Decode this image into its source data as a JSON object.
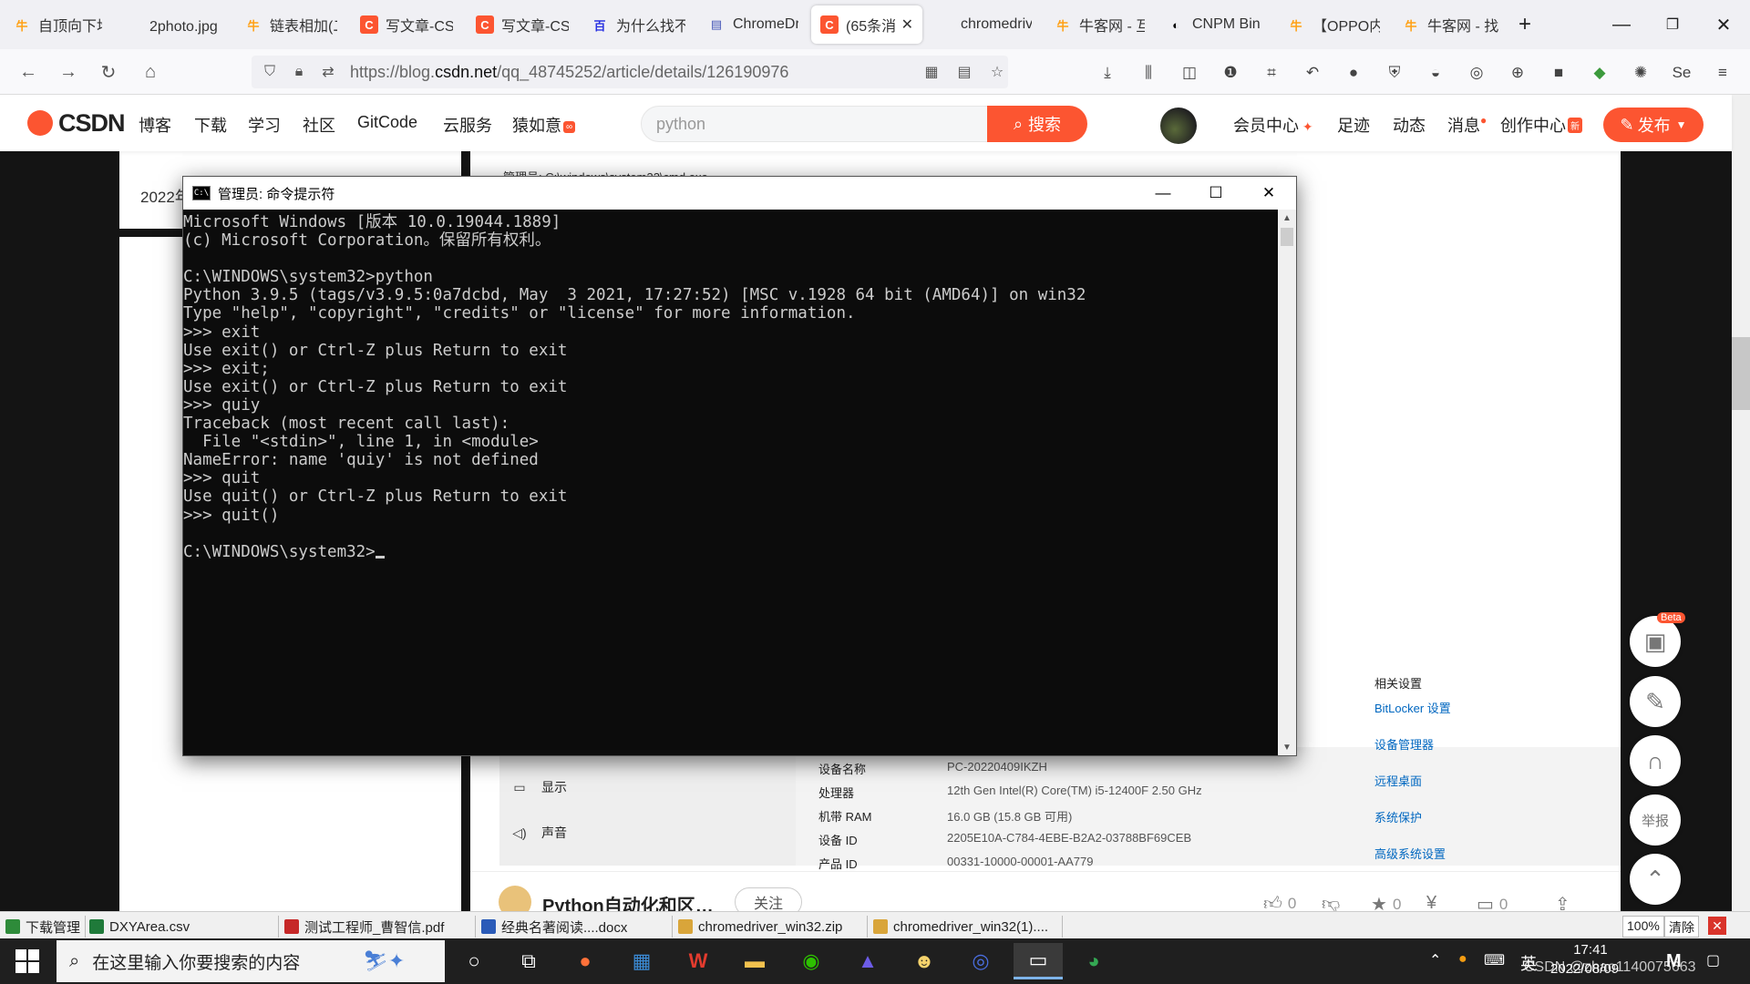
{
  "browser": {
    "tabs": [
      {
        "title": "自顶向下堆",
        "fav": "牛"
      },
      {
        "title": "2photo.jpg（",
        "fav": ""
      },
      {
        "title": "链表相加(二",
        "fav": "牛"
      },
      {
        "title": "写文章-CSI",
        "fav": "C"
      },
      {
        "title": "写文章-CSI",
        "fav": "C"
      },
      {
        "title": "为什么找不",
        "fav": "百"
      },
      {
        "title": "ChromeDr",
        "fav": "▤"
      },
      {
        "title": "(65条消",
        "fav": "C"
      },
      {
        "title": "chromedriver",
        "fav": ""
      },
      {
        "title": "牛客网 - 互",
        "fav": "牛"
      },
      {
        "title": "CNPM Bin",
        "fav": "◐"
      },
      {
        "title": "【OPPO内",
        "fav": "牛"
      },
      {
        "title": "牛客网 - 找",
        "fav": "牛"
      }
    ],
    "new_tab": "+",
    "window_controls": {
      "minimize": "—",
      "restore": "❐",
      "close": "✕"
    },
    "url": {
      "prefix": "https://blog.",
      "domain": "csdn.net",
      "path": "/qq_48745252/article/details/126190976"
    },
    "icons": [
      "back-icon",
      "forward-icon",
      "reload-icon",
      "home-icon",
      "shield-icon",
      "lock-icon",
      "tracking-icon",
      "qr-icon",
      "reader-icon",
      "bookmark-star-icon"
    ]
  },
  "csdn": {
    "logo": "CSDN",
    "nav": [
      "博客",
      "下载",
      "学习",
      "社区",
      "GitCode",
      "云服务",
      "猿如意"
    ],
    "search_placeholder": "python",
    "search_button": "搜索",
    "user_nav": [
      "会员中心",
      "足迹",
      "动态",
      "消息",
      "创作中心"
    ],
    "publish": "发布"
  },
  "page": {
    "year": "2022年",
    "behind_title": "管理员: C:\\windows\\system32\\cmd.exe"
  },
  "settings_screenshot": {
    "nav": [
      {
        "label": "显示",
        "icon": "monitor-icon"
      },
      {
        "label": "声音",
        "icon": "speaker-icon"
      }
    ],
    "specs": [
      {
        "k": "设备名称",
        "v": "PC-20220409IKZH"
      },
      {
        "k": "处理器",
        "v": "12th Gen Intel(R) Core(TM) i5-12400F   2.50 GHz"
      },
      {
        "k": "机带 RAM",
        "v": "16.0 GB (15.8 GB 可用)"
      },
      {
        "k": "设备 ID",
        "v": "2205E10A-C784-4EBE-B2A2-03788BF69CEB"
      },
      {
        "k": "产品 ID",
        "v": "00331-10000-00001-AA779"
      }
    ],
    "related_title": "相关设置",
    "related_links": [
      "BitLocker 设置",
      "设备管理器",
      "远程桌面",
      "系统保护",
      "高级系统设置"
    ]
  },
  "author": {
    "name": "Python自动化和区…",
    "follow": "关注",
    "likes": "0",
    "collects": "0",
    "comments": "0"
  },
  "float_tools": {
    "beta": "Beta",
    "report": "举报"
  },
  "cmd": {
    "title": "管理员: 命令提示符",
    "lines": [
      "Microsoft Windows [版本 10.0.19044.1889]",
      "(c) Microsoft Corporation。保留所有权利。",
      "",
      "C:\\WINDOWS\\system32>python",
      "Python 3.9.5 (tags/v3.9.5:0a7dcbd, May  3 2021, 17:27:52) [MSC v.1928 64 bit (AMD64)] on win32",
      "Type \"help\", \"copyright\", \"credits\" or \"license\" for more information.",
      ">>> exit",
      "Use exit() or Ctrl-Z plus Return to exit",
      ">>> exit;",
      "Use exit() or Ctrl-Z plus Return to exit",
      ">>> quiy",
      "Traceback (most recent call last):",
      "  File \"<stdin>\", line 1, in <module>",
      "NameError: name 'quiy' is not defined",
      ">>> quit",
      "Use quit() or Ctrl-Z plus Return to exit",
      ">>> quit()",
      "",
      "C:\\WINDOWS\\system32>"
    ]
  },
  "downloads": {
    "manager": "下载管理",
    "items": [
      "DXYArea.csv",
      "测试工程师_曹智信.pdf",
      "经典名著阅读....docx",
      "chromedriver_win32.zip",
      "chromedriver_win32(1)...."
    ],
    "zoom": "100%",
    "clear": "清除"
  },
  "taskbar": {
    "search_placeholder": "在这里输入你要搜索的内容",
    "ime": "英",
    "time": "17:41",
    "date": "2022/08/09",
    "watermark": "CSDN @zhao1140075663"
  }
}
